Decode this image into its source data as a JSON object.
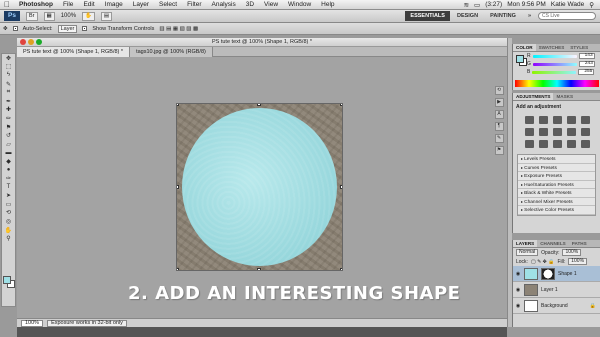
{
  "menubar": {
    "apple": "",
    "items": [
      "Photoshop",
      "File",
      "Edit",
      "Image",
      "Layer",
      "Select",
      "Filter",
      "Analysis",
      "3D",
      "View",
      "Window",
      "Help"
    ],
    "right": {
      "battery": "(3:27)",
      "time": "Mon 9:56 PM",
      "user": "Katie Wade"
    }
  },
  "appbar": {
    "logo": "Ps",
    "zoom": "100%",
    "workspaces": [
      "ESSENTIALS",
      "DESIGN",
      "PAINTING"
    ],
    "search_label": "CS Live"
  },
  "options": {
    "auto_select_label": "Auto-Select:",
    "auto_select_value": "Layer",
    "show_transform_label": "Show Transform Controls"
  },
  "document": {
    "title": "PS tute text @ 100% (Shape 1, RGB/8) *",
    "tabs": [
      "PS tute text @ 100% (Shape 1, RGB/8) *",
      "tags10.jpg @ 100% (RGB/8)"
    ],
    "status_zoom": "100%",
    "status_info": "Exposure works in 32-bit only",
    "caption": "2. ADD AN INTERESTING SHAPE"
  },
  "color_panel": {
    "tabs": [
      "COLOR",
      "SWATCHES",
      "STYLES"
    ],
    "channels": [
      {
        "label": "R",
        "value": "143"
      },
      {
        "label": "G",
        "value": "243"
      },
      {
        "label": "B",
        "value": "255"
      }
    ],
    "fg_color": "#9fe0e6"
  },
  "adjustments_panel": {
    "tabs": [
      "ADJUSTMENTS",
      "MASKS"
    ],
    "title": "Add an adjustment",
    "presets": [
      "Levels Presets",
      "Curves Presets",
      "Exposure Presets",
      "Hue/Saturation Presets",
      "Black & White Presets",
      "Channel Mixer Presets",
      "Selective Color Presets"
    ]
  },
  "layers_panel": {
    "tabs": [
      "LAYERS",
      "CHANNELS",
      "PATHS"
    ],
    "blend_mode": "Normal",
    "opacity_label": "Opacity:",
    "opacity_value": "100%",
    "lock_label": "Lock:",
    "fill_label": "Fill:",
    "fill_value": "100%",
    "layers": [
      {
        "name": "Shape 1",
        "active": true,
        "thumb": "#9fe0e6"
      },
      {
        "name": "Layer 1",
        "active": false,
        "thumb": "#8c8376"
      },
      {
        "name": "Background",
        "active": false,
        "thumb": "#ffffff"
      }
    ]
  }
}
